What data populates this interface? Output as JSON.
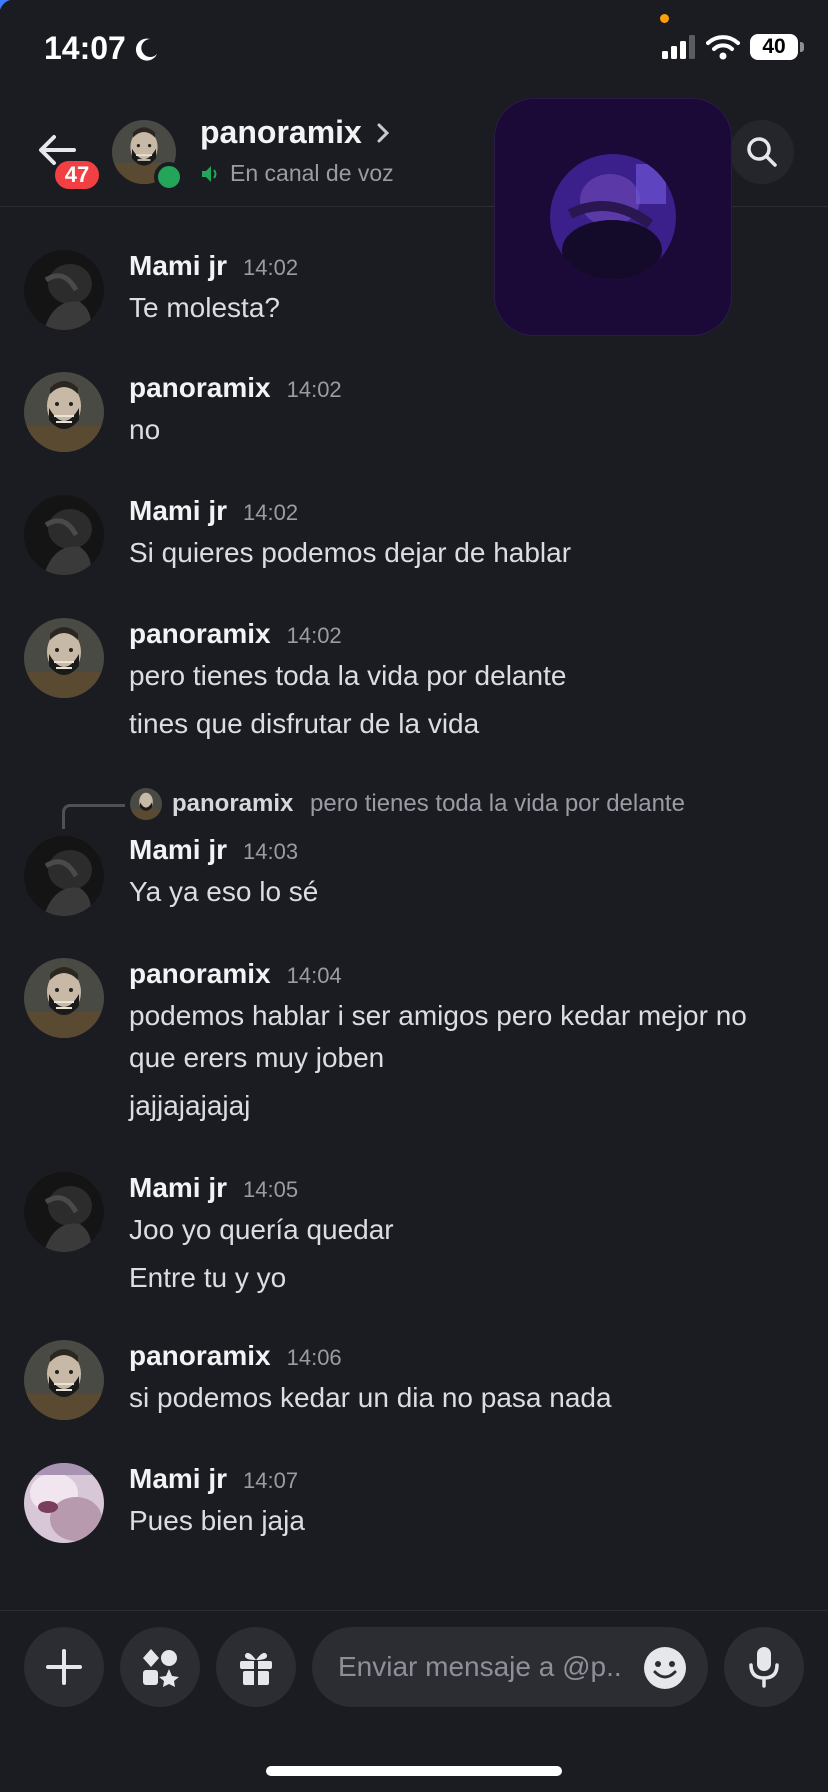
{
  "status_bar": {
    "time": "14:07",
    "battery": "40"
  },
  "header": {
    "unread_count": "47",
    "contact_name": "panoramix",
    "contact_status": "En canal de voz"
  },
  "messages": [
    {
      "author": "Mami jr",
      "time": "14:02",
      "lines": [
        "Te molesta?"
      ]
    },
    {
      "author": "panoramix",
      "time": "14:02",
      "lines": [
        "no"
      ]
    },
    {
      "author": "Mami jr",
      "time": "14:02",
      "lines": [
        "Si quieres podemos dejar de hablar"
      ]
    },
    {
      "author": "panoramix",
      "time": "14:02",
      "lines": [
        "pero tienes toda la vida por delante",
        "tines que disfrutar de la vida"
      ]
    },
    {
      "author": "Mami jr",
      "time": "14:03",
      "lines": [
        "Ya ya eso lo sé"
      ],
      "reply": {
        "author": "panoramix",
        "text": "pero tienes toda la vida por delante"
      }
    },
    {
      "author": "panoramix",
      "time": "14:04",
      "lines": [
        "podemos hablar i ser amigos pero kedar mejor no",
        "que erers muy joben",
        "jajjajajajaj"
      ]
    },
    {
      "author": "Mami jr",
      "time": "14:05",
      "lines": [
        "Joo yo quería quedar",
        "Entre tu y yo"
      ]
    },
    {
      "author": "panoramix",
      "time": "14:06",
      "lines": [
        "si podemos kedar un dia no pasa nada"
      ]
    },
    {
      "author": "Mami jr",
      "time": "14:07",
      "lines": [
        "Pues bien jaja"
      ]
    }
  ],
  "composer": {
    "placeholder": "Enviar mensaje a @p.."
  },
  "icons": {
    "back": "arrow-left-icon",
    "search": "search-icon",
    "voice": "speaker-icon",
    "add": "plus-icon",
    "apps": "apps-icon",
    "gift": "gift-icon",
    "emoji": "emoji-icon",
    "mic": "microphone-icon"
  },
  "colors": {
    "background": "#1b1c21",
    "online": "#23a55a",
    "badge": "#f23f43",
    "voice_tile": "#1b0938"
  }
}
